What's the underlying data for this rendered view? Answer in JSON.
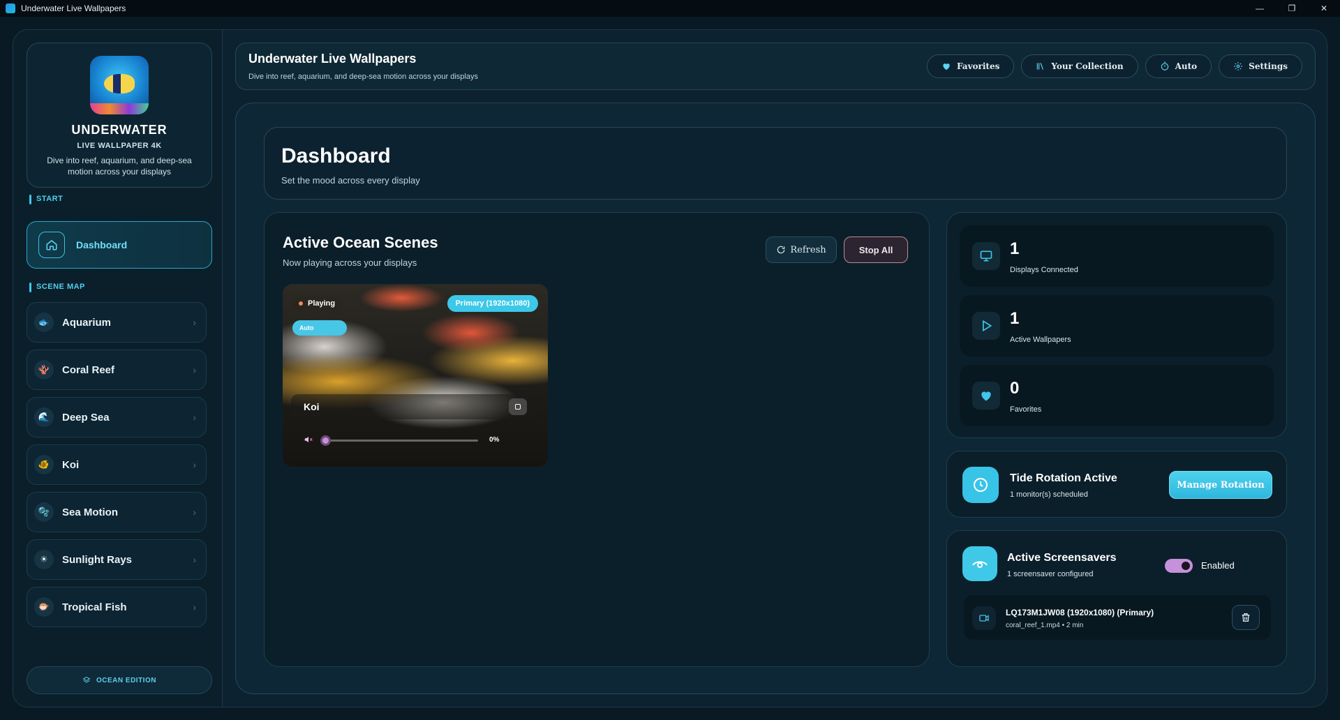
{
  "window": {
    "title": "Underwater Live Wallpapers",
    "minimize": "—",
    "maximize": "❐",
    "close": "✕"
  },
  "brand": {
    "name": "UNDERWATER",
    "sub": "LIVE WALLPAPER 4K",
    "desc": "Dive into reef, aquarium, and deep-sea motion across your displays"
  },
  "sidebar": {
    "start_label": "START",
    "dashboard_label": "Dashboard",
    "scene_map_label": "SCENE MAP",
    "items": [
      {
        "label": "Aquarium",
        "icon": "aquarium-icon",
        "glyph": "🐟"
      },
      {
        "label": "Coral Reef",
        "icon": "coral-reef-icon",
        "glyph": "🪸"
      },
      {
        "label": "Deep Sea",
        "icon": "deep-sea-icon",
        "glyph": "🌊"
      },
      {
        "label": "Koi",
        "icon": "koi-icon",
        "glyph": "🐠"
      },
      {
        "label": "Sea Motion",
        "icon": "sea-motion-icon",
        "glyph": "🫧"
      },
      {
        "label": "Sunlight Rays",
        "icon": "sunlight-rays-icon",
        "glyph": "☀"
      },
      {
        "label": "Tropical Fish",
        "icon": "tropical-fish-icon",
        "glyph": "🐡"
      }
    ],
    "edition_label": "OCEAN EDITION"
  },
  "header": {
    "title": "Underwater Live Wallpapers",
    "subtitle": "Dive into reef, aquarium, and deep-sea motion across your displays",
    "favorites": "Favorites",
    "collection": "Your Collection",
    "auto": "Auto",
    "settings": "Settings"
  },
  "dashboard": {
    "title": "Dashboard",
    "subtitle": "Set the mood across every display"
  },
  "scenes": {
    "title": "Active Ocean Scenes",
    "subtitle": "Now playing across your displays",
    "refresh": "Refresh",
    "stop_all": "Stop All",
    "card": {
      "status": "Playing",
      "monitor": "Primary (1920x1080)",
      "mode": "Auto",
      "name": "Koi",
      "volume_percent": "0%",
      "volume_value": 0
    }
  },
  "stats": [
    {
      "value": "1",
      "label": "Displays Connected",
      "icon": "monitor-icon"
    },
    {
      "value": "1",
      "label": "Active Wallpapers",
      "icon": "play-icon"
    },
    {
      "value": "0",
      "label": "Favorites",
      "icon": "heart-icon"
    }
  ],
  "tide": {
    "title": "Tide Rotation Active",
    "subtitle": "1 monitor(s) scheduled",
    "button": "Manage Rotation"
  },
  "screensavers": {
    "title": "Active Screensavers",
    "subtitle": "1 screensaver configured",
    "toggle_label": "Enabled",
    "toggle_on": true,
    "entry": {
      "name": "LQ173M1JW08 (1920x1080) (Primary)",
      "meta": "coral_reef_1.mp4 • 2 min"
    }
  },
  "colors": {
    "accent": "#3fc6ea",
    "toggle": "#c690da",
    "stop_border": "#c28a90"
  }
}
